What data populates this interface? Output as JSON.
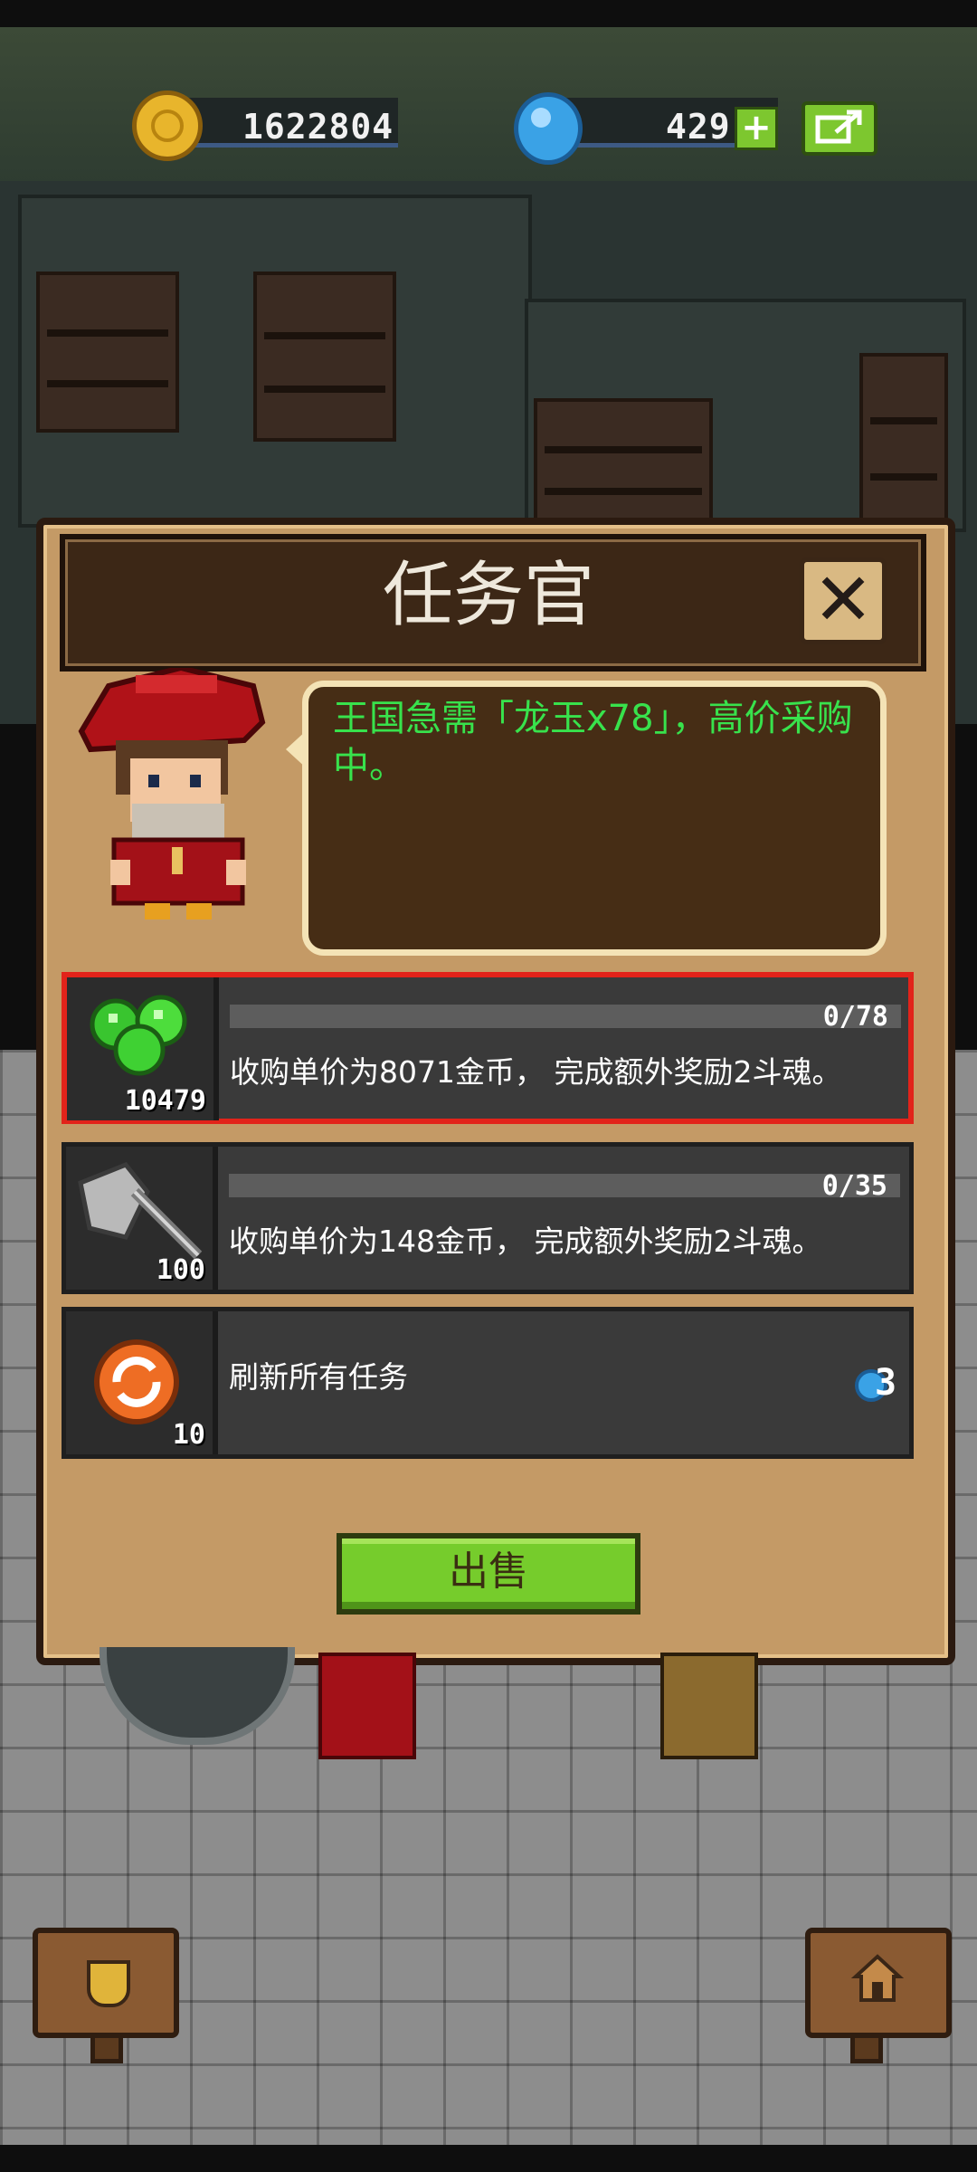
{
  "currency": {
    "gold": "1622804",
    "gems": "429"
  },
  "dialog": {
    "title": "任务官",
    "message": "王国急需「龙玉x78」，高价采购中。"
  },
  "tasks": [
    {
      "item_icon": "green-gems-icon",
      "item_count": "10479",
      "progress_text": "0/78",
      "progress": 0,
      "description": "收购单价为8071金币， 完成额外奖励2斗魂。",
      "selected": true
    },
    {
      "item_icon": "axe-icon",
      "item_count": "100",
      "progress_text": "0/35",
      "progress": 0,
      "description": "收购单价为148金币， 完成额外奖励2斗魂。",
      "selected": false
    }
  ],
  "refresh": {
    "item_icon": "refresh-coin-icon",
    "item_count": "10",
    "label": "刷新所有任务",
    "cost": "3",
    "cost_icon": "blue-gem-icon"
  },
  "sell_button": "出售",
  "colors": {
    "speech_text": "#38e24c",
    "sell_button": "#76cc2c",
    "selection_border": "#e2231a",
    "dialog_bg": "#c49a66"
  }
}
